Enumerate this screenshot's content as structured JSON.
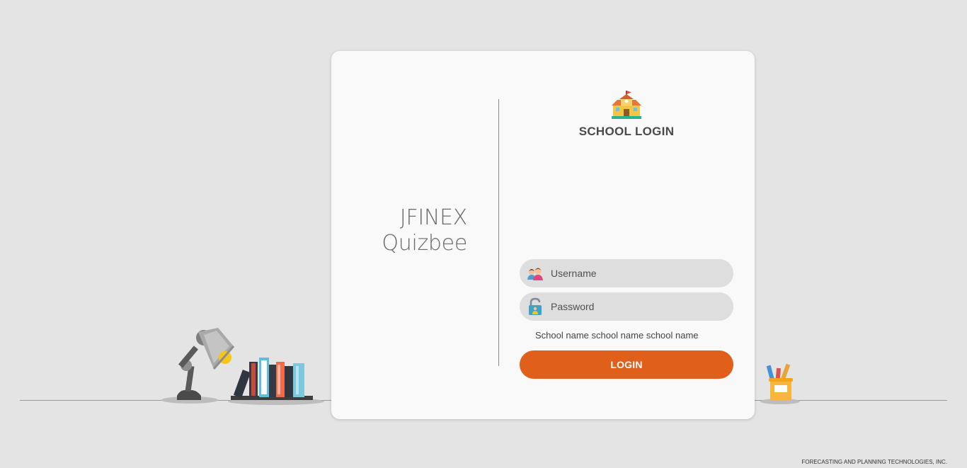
{
  "brand": {
    "line1": "JFINEX",
    "line2": "Quizbee"
  },
  "login": {
    "icon": "school-building-icon",
    "title": "SCHOOL LOGIN",
    "username": {
      "placeholder": "Username",
      "value": "",
      "icon": "users-icon"
    },
    "password": {
      "placeholder": "Password",
      "value": "",
      "icon": "padlock-icon"
    },
    "school_name": "School name school name school name",
    "button_label": "LOGIN"
  },
  "decorations": [
    "desk-lamp-illustration",
    "books-illustration",
    "pencil-cup-illustration"
  ],
  "footer": {
    "company": "FORECASTING AND PLANNING TECHNOLOGIES, INC."
  },
  "colors": {
    "background": "#e4e4e4",
    "card": "#f9f9f9",
    "accent": "#e05f1b",
    "field": "#dedede"
  }
}
